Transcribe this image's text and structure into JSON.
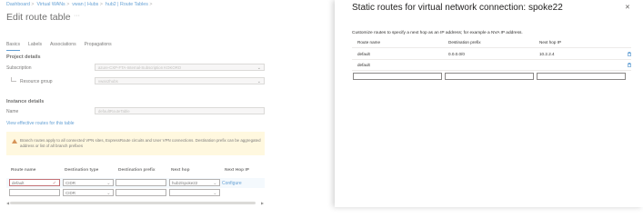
{
  "breadcrumb": {
    "items": [
      "Dashboard",
      "Virtual WANs",
      "vwan | Hubs",
      "hub2 | Route Tables"
    ]
  },
  "page": {
    "title": "Edit route table",
    "ellipsis": "···"
  },
  "tabs": [
    {
      "label": "Basics",
      "active": true
    },
    {
      "label": "Labels",
      "active": false
    },
    {
      "label": "Associations",
      "active": false
    },
    {
      "label": "Propagations",
      "active": false
    }
  ],
  "project_details": {
    "heading": "Project details",
    "subscription_label": "Subscription",
    "subscription_value": "azure-CXP-FTA-Internal-Subscription KOKORO",
    "resource_group_label": "Resource group",
    "resource_group_value": "vwan2hubs"
  },
  "instance_details": {
    "heading": "Instance details",
    "name_label": "Name",
    "name_value": "defaultRouteTable"
  },
  "effective_routes_link": "View effective routes for this table",
  "warning": {
    "text": "Branch routes apply to all connected VPN sites, ExpressRoute circuits and User VPN connections. Destination prefix can be aggregated address or list of all branch prefixes"
  },
  "routes_table": {
    "headers": [
      "Route name",
      "Destination type",
      "Destination prefix",
      "Next hop",
      "Next Hop IP"
    ],
    "rows": [
      {
        "route_name": "default",
        "destination_type": "CIDR",
        "destination_prefix": "",
        "next_hop": "hub2/spoke22",
        "next_hop_ip": "Configure"
      },
      {
        "route_name": "",
        "destination_type": "CIDR",
        "destination_prefix": "",
        "next_hop": "",
        "next_hop_ip": ""
      }
    ]
  },
  "static_routes_panel": {
    "title": "Static routes for virtual network connection: spoke22",
    "close_icon": "close-icon",
    "description": "Customize routes to specify a next hop as an IP address; for example a NVA IP address.",
    "headers": [
      "Route name",
      "Destination prefix",
      "Next hop IP"
    ],
    "rows": [
      {
        "route_name": "default",
        "destination_prefix": "0.0.0.0/0",
        "next_hop_ip": "10.2.2.4"
      },
      {
        "route_name": "default",
        "destination_prefix": "",
        "next_hop_ip": ""
      }
    ]
  },
  "colors": {
    "accent": "#0f6cbd",
    "warning_bg": "#fff4ce",
    "warning_icon": "#c15d01",
    "error": "#a4262c"
  }
}
